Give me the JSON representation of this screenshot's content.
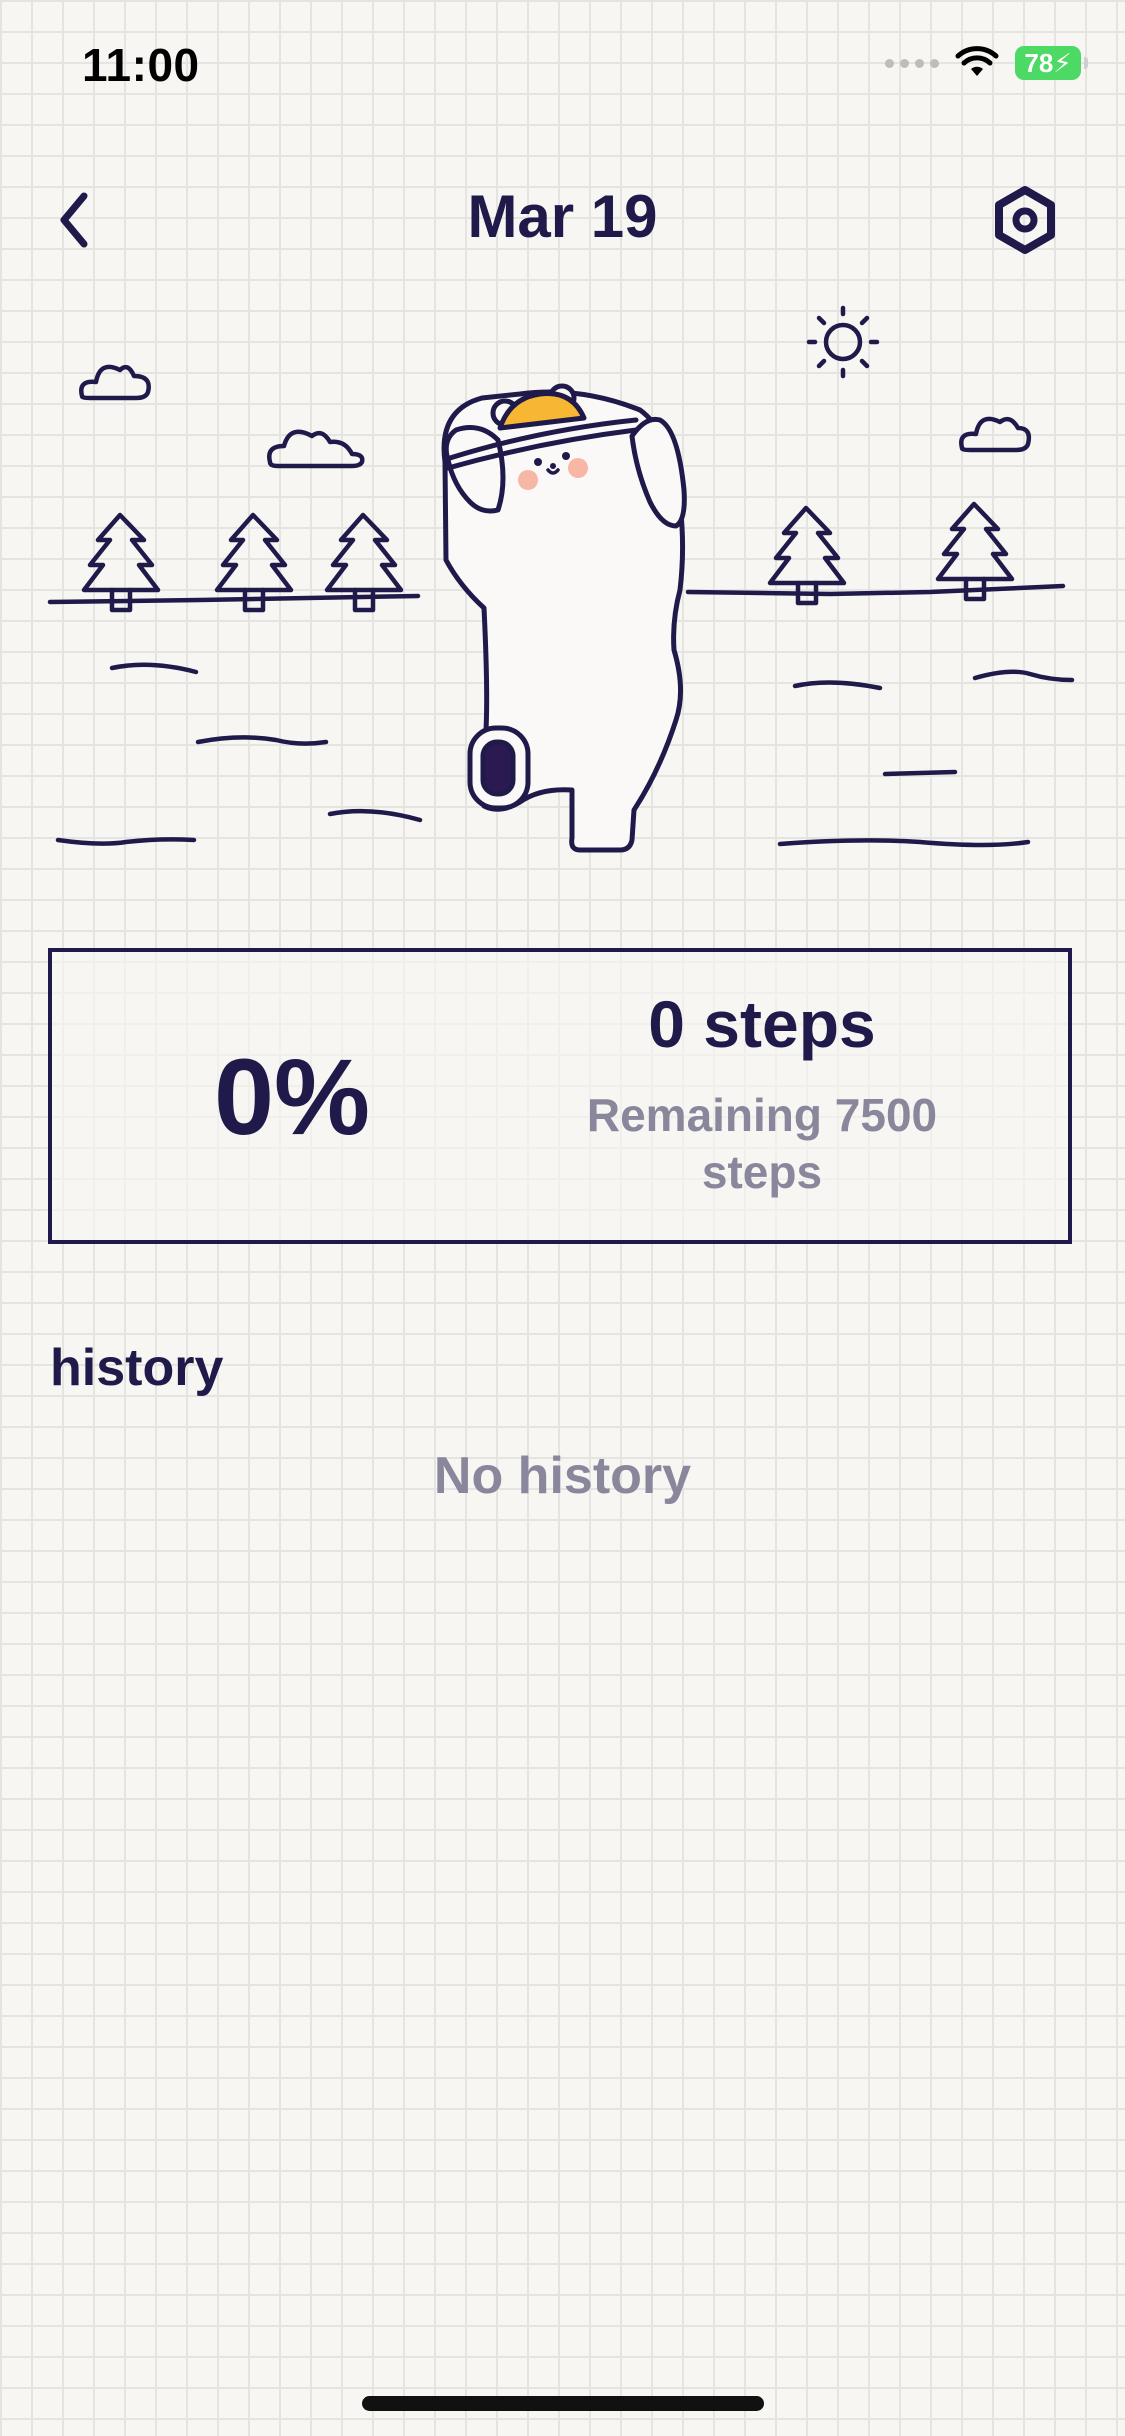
{
  "status_bar": {
    "time": "11:00",
    "battery": "78",
    "icons": [
      "cellular-signal-icon",
      "wifi-icon",
      "battery-charging-icon"
    ]
  },
  "header": {
    "title": "Mar 19",
    "back_icon": "chevron-left-icon",
    "settings_icon": "hexagon-settings-icon"
  },
  "progress": {
    "percent": "0%",
    "steps": "0 steps",
    "remaining": "Remaining 7500 steps"
  },
  "history": {
    "heading": "history",
    "empty": "No history"
  },
  "colors": {
    "ink": "#1f1a4a",
    "muted": "#8a879c",
    "background": "#f7f6f3",
    "hat": "#f7b733",
    "battery": "#4cd964"
  }
}
